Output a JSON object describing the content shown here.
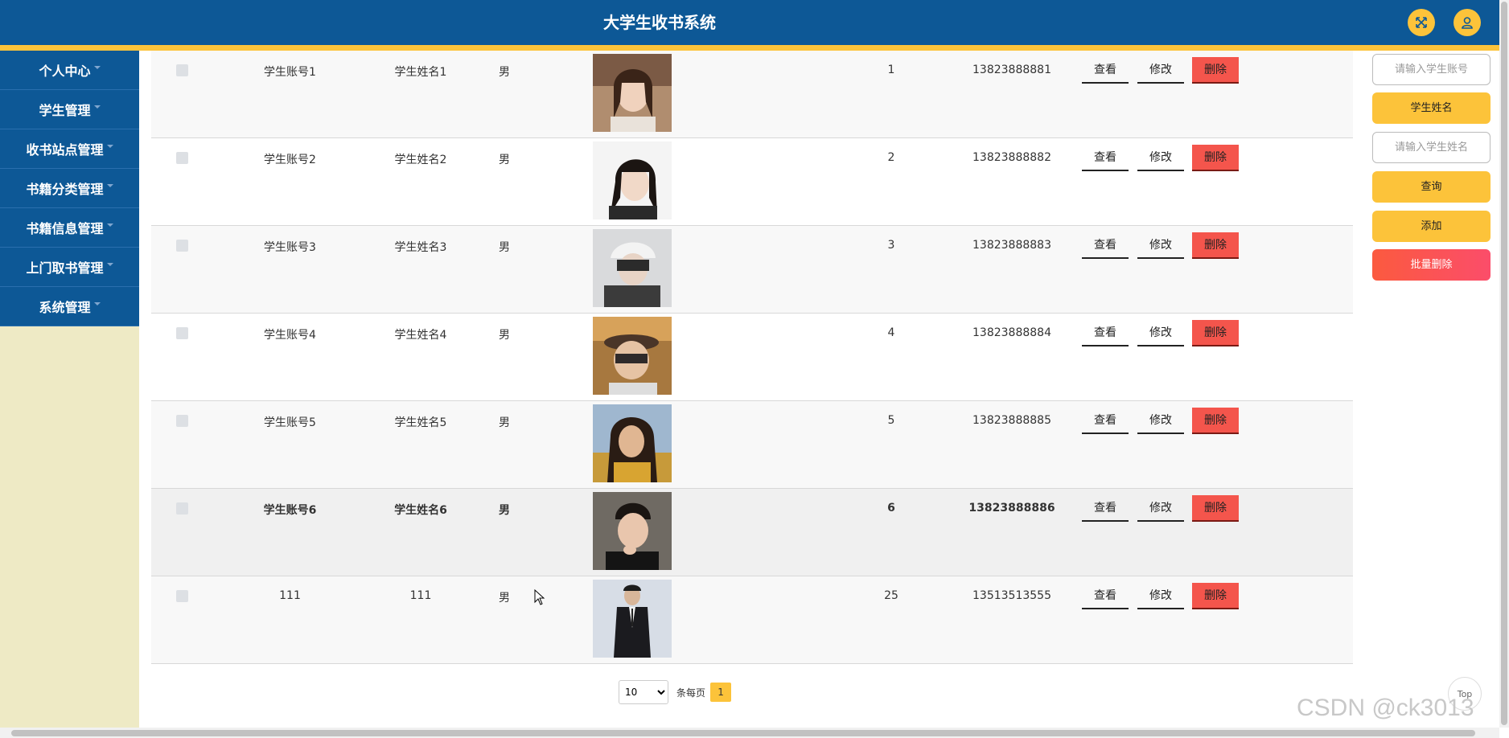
{
  "header": {
    "title": "大学生收书系统"
  },
  "sidebar": {
    "items": [
      {
        "label": "个人中心"
      },
      {
        "label": "学生管理"
      },
      {
        "label": "收书站点管理"
      },
      {
        "label": "书籍分类管理"
      },
      {
        "label": "书籍信息管理"
      },
      {
        "label": "上门取书管理"
      },
      {
        "label": "系统管理"
      }
    ]
  },
  "table": {
    "actions": {
      "view": "查看",
      "edit": "修改",
      "delete": "删除"
    },
    "rows": [
      {
        "account": "学生账号1",
        "name": "学生姓名1",
        "sex": "男",
        "num": "1",
        "phone": "13823888881"
      },
      {
        "account": "学生账号2",
        "name": "学生姓名2",
        "sex": "男",
        "num": "2",
        "phone": "13823888882"
      },
      {
        "account": "学生账号3",
        "name": "学生姓名3",
        "sex": "男",
        "num": "3",
        "phone": "13823888883"
      },
      {
        "account": "学生账号4",
        "name": "学生姓名4",
        "sex": "男",
        "num": "4",
        "phone": "13823888884"
      },
      {
        "account": "学生账号5",
        "name": "学生姓名5",
        "sex": "男",
        "num": "5",
        "phone": "13823888885"
      },
      {
        "account": "学生账号6",
        "name": "学生姓名6",
        "sex": "男",
        "num": "6",
        "phone": "13823888886"
      },
      {
        "account": "111",
        "name": "111",
        "sex": "男",
        "num": "25",
        "phone": "13513513555"
      }
    ]
  },
  "pagination": {
    "page_size": "10",
    "per_page_label": "条每页",
    "current_page": "1"
  },
  "search": {
    "account_placeholder": "请输入学生账号",
    "name_label": "学生姓名",
    "name_placeholder": "请输入学生姓名",
    "query_label": "查询",
    "add_label": "添加",
    "batch_delete_label": "批量删除"
  },
  "top_button": "Top",
  "watermark": "CSDN @ck3013",
  "colors": {
    "header_blue": "#0d5896",
    "accent_yellow": "#fcc33a",
    "delete_red": "#f4554c",
    "sidebar_bg": "#eeeac5"
  }
}
